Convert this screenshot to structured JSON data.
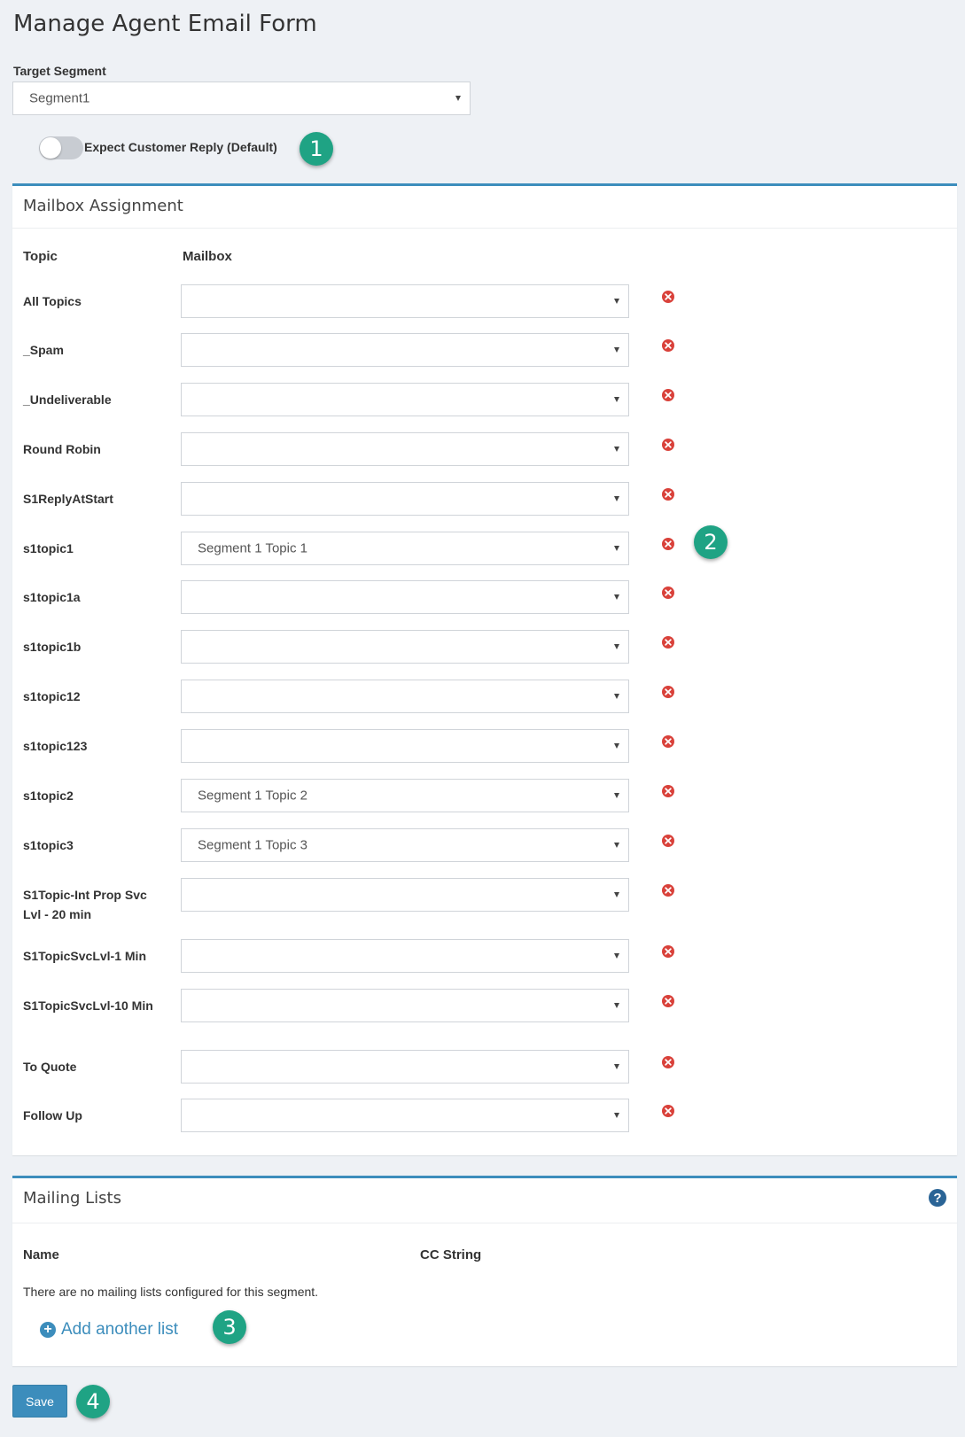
{
  "page": {
    "title": "Manage Agent Email Form"
  },
  "target_segment": {
    "label": "Target Segment",
    "value": "Segment1"
  },
  "expect_reply": {
    "label": "Expect Customer Reply (Default)",
    "enabled": false
  },
  "callouts": [
    "1",
    "2",
    "3",
    "4"
  ],
  "mailbox_assignment": {
    "title": "Mailbox Assignment",
    "col_topic": "Topic",
    "col_mailbox": "Mailbox",
    "rows": [
      {
        "topic": "All Topics",
        "mailbox": ""
      },
      {
        "topic": "_Spam",
        "mailbox": ""
      },
      {
        "topic": "_Undeliverable",
        "mailbox": ""
      },
      {
        "topic": "Round Robin",
        "mailbox": ""
      },
      {
        "topic": "S1ReplyAtStart",
        "mailbox": ""
      },
      {
        "topic": "s1topic1",
        "mailbox": "Segment 1 Topic 1"
      },
      {
        "topic": "s1topic1a",
        "mailbox": ""
      },
      {
        "topic": "s1topic1b",
        "mailbox": ""
      },
      {
        "topic": "s1topic12",
        "mailbox": ""
      },
      {
        "topic": "s1topic123",
        "mailbox": ""
      },
      {
        "topic": "s1topic2",
        "mailbox": "Segment 1 Topic 2"
      },
      {
        "topic": "s1topic3",
        "mailbox": "Segment 1 Topic 3"
      },
      {
        "topic": "S1Topic-Int Prop Svc Lvl - 20 min",
        "mailbox": ""
      },
      {
        "topic": "S1TopicSvcLvl-1 Min",
        "mailbox": ""
      },
      {
        "topic": "S1TopicSvcLvl-10 Min",
        "mailbox": ""
      },
      {
        "topic": "To Quote",
        "mailbox": ""
      },
      {
        "topic": "Follow Up",
        "mailbox": ""
      }
    ],
    "remove_icon": "close-circle-icon"
  },
  "mailing_lists": {
    "title": "Mailing Lists",
    "help_icon": "question-circle-icon",
    "help_glyph": "?",
    "col_name": "Name",
    "col_cc": "CC String",
    "empty_message": "There are no mailing lists configured for this segment.",
    "add_label": "Add another list",
    "add_icon": "plus-circle-icon",
    "add_glyph": "+"
  },
  "actions": {
    "save_label": "Save"
  },
  "colors": {
    "accent": "#3c8dbc",
    "danger": "#d9413a",
    "callout": "#1fa384"
  }
}
